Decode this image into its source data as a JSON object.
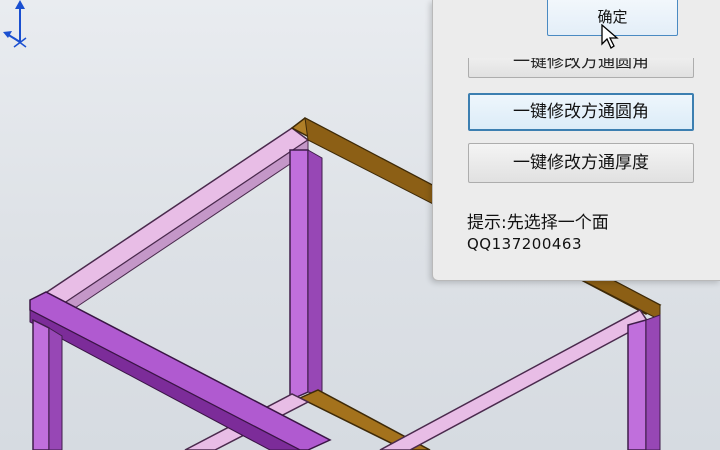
{
  "dialog": {
    "confirm_button": "确定",
    "partial_button": "一键修改方通圆角",
    "fillet_button": "一键修改方通圆角",
    "thickness_button": "一键修改方通厚度",
    "hint": "提示:先选择一个面",
    "qq": "QQ137200463"
  },
  "colors": {
    "purple_frame": "#b75fd3",
    "light_frame": "#e8bde6",
    "orange_frame": "#a4721c",
    "accent": "#3c7fb1"
  },
  "icons": [
    "mouse-cursor-icon",
    "axis-triad-icon"
  ]
}
